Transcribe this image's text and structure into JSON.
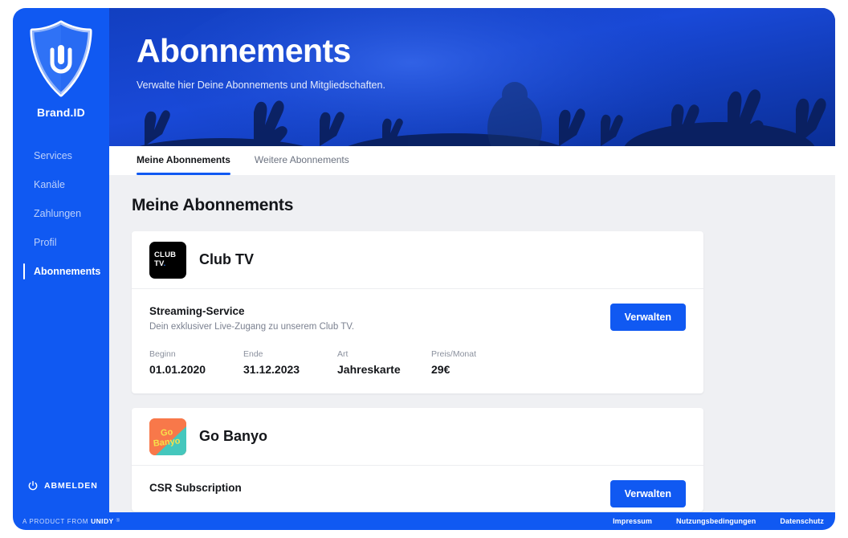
{
  "sidebar": {
    "brand_name": "Brand.ID",
    "logo_icon": "shield-u-logo",
    "items": [
      {
        "label": "Services",
        "active": false
      },
      {
        "label": "Kanäle",
        "active": false
      },
      {
        "label": "Zahlungen",
        "active": false
      },
      {
        "label": "Profil",
        "active": false
      },
      {
        "label": "Abonnements",
        "active": true
      }
    ],
    "logout": {
      "label": "ABMELDEN",
      "icon": "power-icon"
    }
  },
  "hero": {
    "title": "Abonnements",
    "subtitle": "Verwalte hier Deine Abonnements und Mitgliedschaften.",
    "background": "concert-crowd-photo",
    "accent": "#1059f2"
  },
  "tabs": [
    {
      "label": "Meine Abonnements",
      "active": true
    },
    {
      "label": "Weitere Abonnements",
      "active": false
    }
  ],
  "content": {
    "section_title": "Meine Abonnements",
    "cards": [
      {
        "brand": "Club TV",
        "logo": {
          "kind": "clubtv",
          "line1": "CLUB",
          "line2": "TV",
          "dot": "."
        },
        "plan_name": "Streaming-Service",
        "plan_desc": "Dein exklusiver Live-Zugang zu unserem  Club TV.",
        "manage_label": "Verwalten",
        "facts": [
          {
            "label": "Beginn",
            "value": "01.01.2020"
          },
          {
            "label": "Ende",
            "value": "31.12.2023"
          },
          {
            "label": "Art",
            "value": "Jahreskarte"
          },
          {
            "label": "Preis/Monat",
            "value": "29€"
          }
        ]
      },
      {
        "brand": "Go Banyo",
        "logo": {
          "kind": "gobanyo",
          "line1": "Go",
          "line2": "Banyo"
        },
        "plan_name": "CSR Subscription",
        "manage_label": "Verwalten"
      }
    ]
  },
  "footer": {
    "product_prefix": "A PRODUCT FROM",
    "product_brand": "UNIDY",
    "product_mark": "®",
    "links": [
      {
        "label": "Impressum"
      },
      {
        "label": "Nutzungsbedingungen"
      },
      {
        "label": "Datenschutz"
      }
    ]
  }
}
